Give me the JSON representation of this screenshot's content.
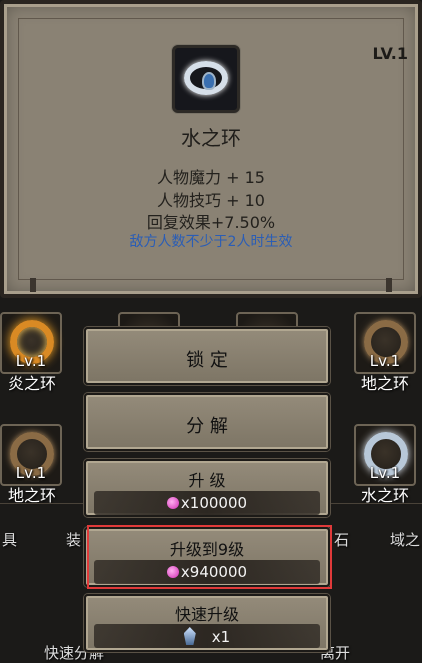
{
  "item": {
    "name": "水之环",
    "level": "LV.1",
    "icon": "water-ring-icon",
    "stats": [
      "人物魔力 + 15",
      "人物技巧 + 10",
      "回复效果+7.50%"
    ],
    "condition": "敌方人数不少于2人时生效"
  },
  "background_slots": [
    {
      "level": "Lv.1",
      "name": "炎之环",
      "icon": "fire-ring-icon"
    },
    {
      "level": "Lv.1",
      "name": "地之环",
      "icon": "earth-ring-icon"
    },
    {
      "level": "Lv.1",
      "name": "地之环",
      "icon": "earth-ring-icon"
    },
    {
      "level": "Lv.1",
      "name": "水之环",
      "icon": "water-ring-icon"
    }
  ],
  "background_tabs": [
    "具",
    "装",
    "石",
    "域之"
  ],
  "background_bottom": {
    "left": "快速分解",
    "right": "离开"
  },
  "menu": {
    "lock": "锁 定",
    "decompose": "分 解",
    "upgrade": {
      "label": "升 级",
      "cost": "x100000"
    },
    "upgrade_to": {
      "label": "升级到9级",
      "cost": "x940000"
    },
    "quick_upgrade": {
      "label": "快速升级",
      "cost": "x1"
    }
  },
  "colors": {
    "condition_text": "#2a5db6",
    "highlight": "#e03a3a",
    "gem": "#d12ab3"
  }
}
